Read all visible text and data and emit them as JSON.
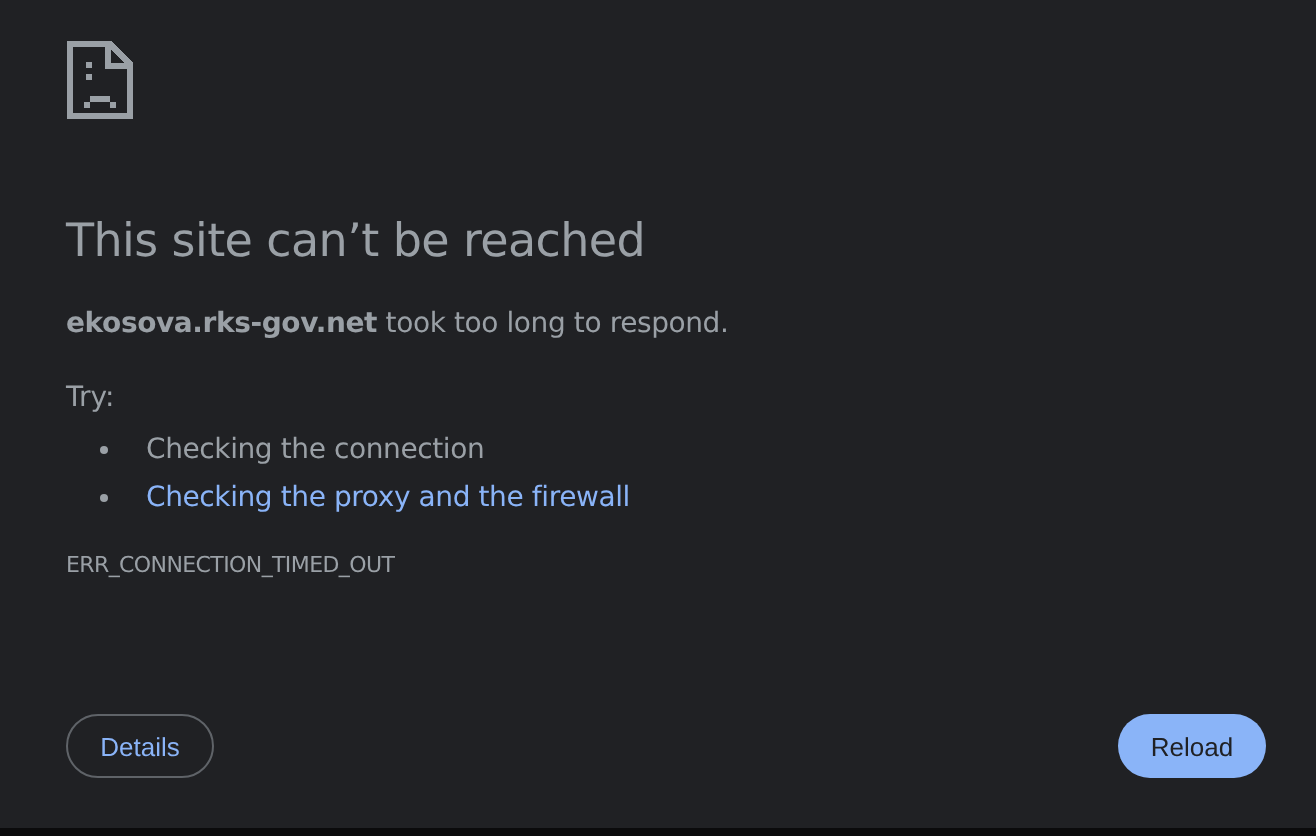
{
  "heading": "This site can’t be reached",
  "message": "**ekosova.rks-gov.net** took too long to respond.",
  "try_label": "Try:",
  "suggestions": [
    {
      "kind": "text",
      "label": "Checking the connection"
    },
    {
      "kind": "link",
      "label": "Checking the proxy and the firewall"
    }
  ],
  "error_code": "ERR_CONNECTION_TIMED_OUT",
  "buttons": [
    {
      "label": "Details",
      "kind": "secondary"
    },
    {
      "label": "Reload",
      "kind": "primary"
    }
  ]
}
